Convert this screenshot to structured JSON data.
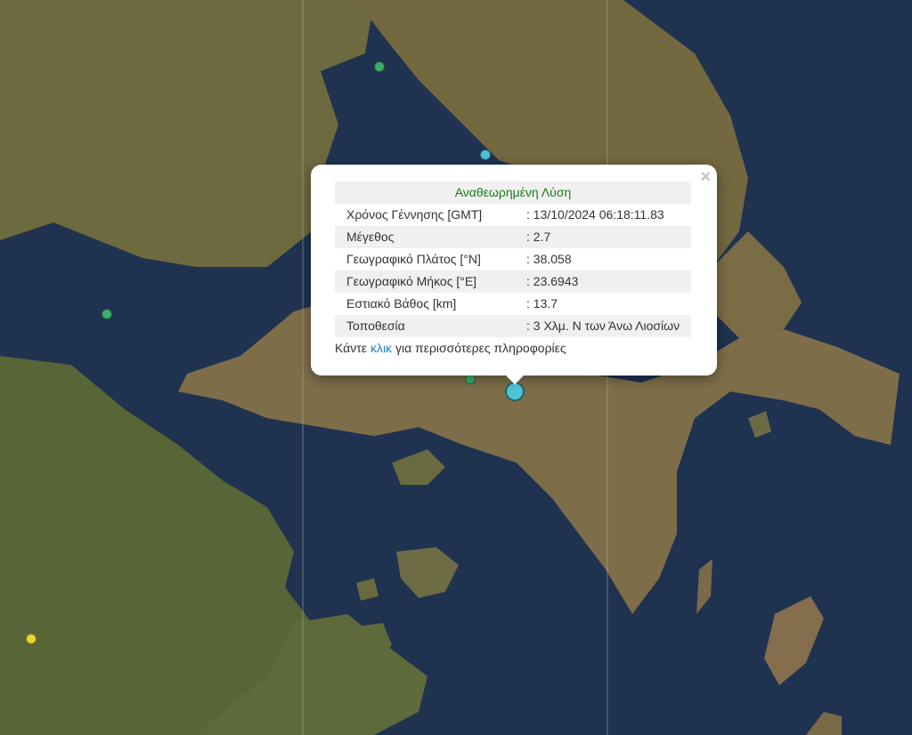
{
  "map": {
    "markers": [
      {
        "name": "green",
        "color": "#3dad6a"
      },
      {
        "name": "cyan",
        "color": "#4dc3d6"
      },
      {
        "name": "green",
        "color": "#3dad6a"
      },
      {
        "name": "green",
        "color": "#3dad6a"
      },
      {
        "name": "selected-cyan",
        "color": "#4dc3d6"
      },
      {
        "name": "yellow",
        "color": "#f2d23b"
      }
    ]
  },
  "popup": {
    "close_glyph": "×",
    "header": "Αναθεωρημένη Λύση",
    "rows": [
      {
        "label": "Χρόνος Γέννησης [GMT]",
        "value": ": 13/10/2024 06:18:11.83"
      },
      {
        "label": "Μέγεθος",
        "value": ": 2.7"
      },
      {
        "label": "Γεωγραφικό Πλάτος [°N]",
        "value": ": 38.058"
      },
      {
        "label": "Γεωγραφικό Μήκος [°E]",
        "value": ": 23.6943"
      },
      {
        "label": "Εστιακό Βάθος [km]",
        "value": ": 13.7"
      },
      {
        "label": "Τοποθεσία",
        "value": ": 3 Χλμ. Ν των Άνω Λιοσίων"
      }
    ],
    "more_prefix": "Κάντε",
    "more_link": "κλικ",
    "more_suffix": "για περισσότερες πληροφορίες"
  }
}
